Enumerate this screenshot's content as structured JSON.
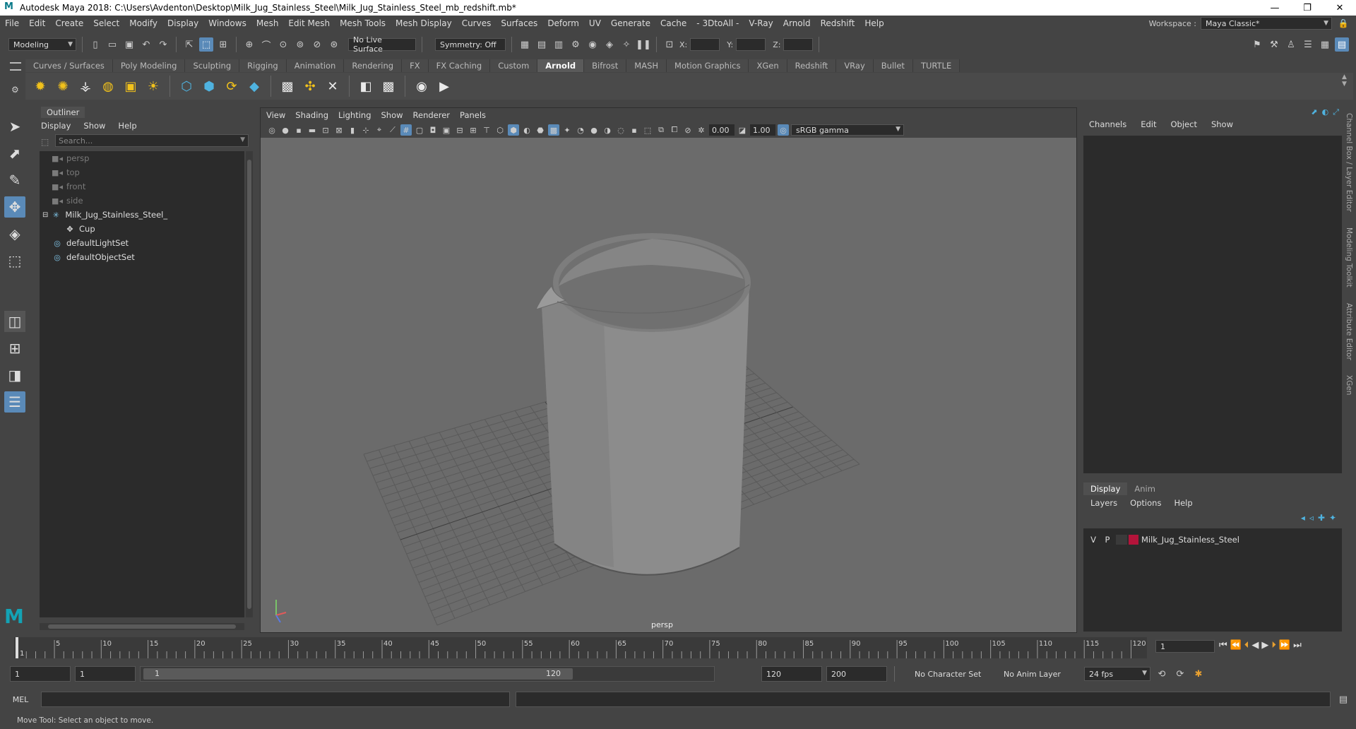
{
  "window": {
    "title": "Autodesk Maya 2018: C:\\Users\\Avdenton\\Desktop\\Milk_Jug_Stainless_Steel\\Milk_Jug_Stainless_Steel_mb_redshift.mb*",
    "minimize": "—",
    "maximize": "❐",
    "close": "✕"
  },
  "menu": [
    "File",
    "Edit",
    "Create",
    "Select",
    "Modify",
    "Display",
    "Windows",
    "Mesh",
    "Edit Mesh",
    "Mesh Tools",
    "Mesh Display",
    "Curves",
    "Surfaces",
    "Deform",
    "UV",
    "Generate",
    "Cache",
    "- 3DtoAll -",
    "V-Ray",
    "Arnold",
    "Redshift",
    "Help"
  ],
  "workspace": {
    "label": "Workspace :",
    "value": "Maya Classic*"
  },
  "statusline": {
    "mode": "Modeling",
    "live_surface": "No Live Surface",
    "symmetry": "Symmetry: Off",
    "x_label": "X:",
    "y_label": "Y:",
    "z_label": "Z:"
  },
  "shelf_tabs": [
    "Curves / Surfaces",
    "Poly Modeling",
    "Sculpting",
    "Rigging",
    "Animation",
    "Rendering",
    "FX",
    "FX Caching",
    "Custom",
    "Arnold",
    "Bifrost",
    "MASH",
    "Motion Graphics",
    "XGen",
    "Redshift",
    "VRay",
    "Bullet",
    "TURTLE"
  ],
  "active_shelf_tab": "Arnold",
  "outliner": {
    "title": "Outliner",
    "menu": [
      "Display",
      "Show",
      "Help"
    ],
    "search_placeholder": "Search...",
    "items": [
      {
        "label": "persp",
        "icon": "camera-icon",
        "dim": true,
        "indent": 0
      },
      {
        "label": "top",
        "icon": "camera-icon",
        "dim": true,
        "indent": 0
      },
      {
        "label": "front",
        "icon": "camera-icon",
        "dim": true,
        "indent": 0
      },
      {
        "label": "side",
        "icon": "camera-icon",
        "dim": true,
        "indent": 0
      },
      {
        "label": "Milk_Jug_Stainless_Steel_",
        "icon": "group-icon",
        "dim": false,
        "indent": 0,
        "expander": "−"
      },
      {
        "label": "Cup",
        "icon": "mesh-icon",
        "dim": false,
        "indent": 1
      },
      {
        "label": "defaultLightSet",
        "icon": "set-icon",
        "dim": false,
        "indent": 0
      },
      {
        "label": "defaultObjectSet",
        "icon": "set-icon",
        "dim": false,
        "indent": 0
      }
    ]
  },
  "viewport": {
    "menu": [
      "View",
      "Shading",
      "Lighting",
      "Show",
      "Renderer",
      "Panels"
    ],
    "exposure": "0.00",
    "gamma": "1.00",
    "color_space": "sRGB gamma",
    "camera_label": "persp"
  },
  "channelbox": {
    "menu": [
      "Channels",
      "Edit",
      "Object",
      "Show"
    ],
    "side_tabs": [
      "Channel Box / Layer Editor",
      "Modeling Toolkit",
      "Attribute Editor",
      "XGen"
    ]
  },
  "layers": {
    "tabs": [
      "Display",
      "Anim"
    ],
    "active_tab": "Display",
    "menu": [
      "Layers",
      "Options",
      "Help"
    ],
    "rows": [
      {
        "v": "V",
        "p": "P",
        "color": "#b3143a",
        "name": "Milk_Jug_Stainless_Steel"
      }
    ]
  },
  "timeline": {
    "ticks": [
      "5",
      "10",
      "15",
      "20",
      "25",
      "30",
      "35",
      "40",
      "45",
      "50",
      "55",
      "60",
      "65",
      "70",
      "75",
      "80",
      "85",
      "90",
      "95",
      "100",
      "105",
      "110",
      "115",
      "120"
    ],
    "first_tick": "1",
    "current_frame": "1"
  },
  "range": {
    "start": "1",
    "playback_start": "1",
    "slider_start": "1",
    "slider_end": "120",
    "playback_end": "120",
    "end": "200",
    "character_set": "No Character Set",
    "anim_layer": "No Anim Layer",
    "fps": "24 fps"
  },
  "command": {
    "label": "MEL"
  },
  "help_line": "Move Tool: Select an object to move.",
  "colors": {
    "accent": "#5a8ab8",
    "layer_color": "#b3143a",
    "maya_logo": "#13a3b5"
  }
}
